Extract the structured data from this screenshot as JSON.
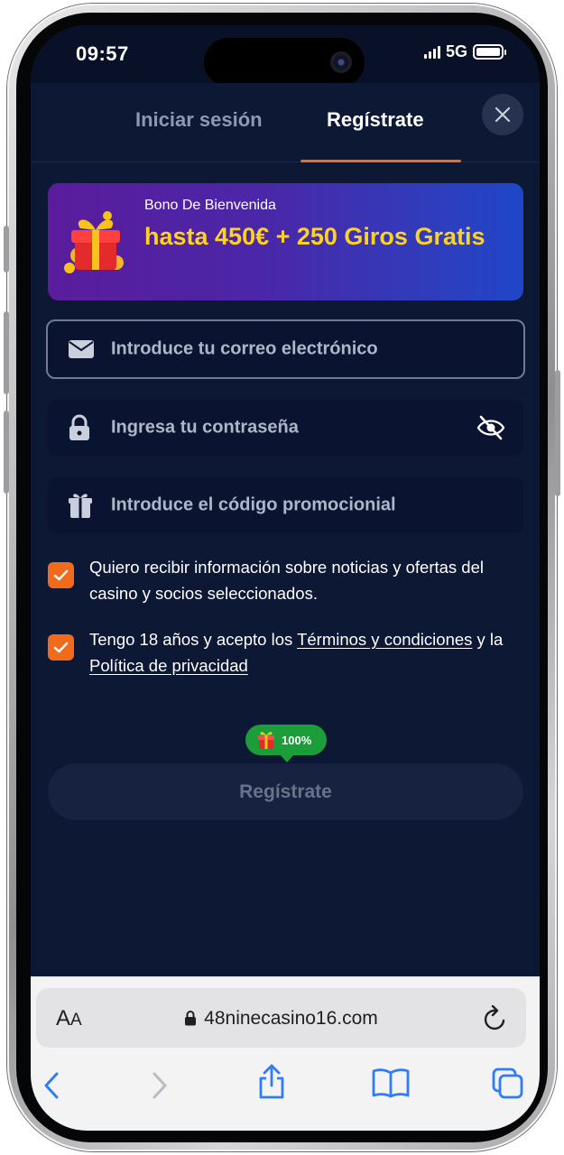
{
  "status_bar": {
    "time": "09:57",
    "network": "5G"
  },
  "tabs": {
    "login": "Iniciar sesión",
    "register": "Regístrate"
  },
  "bonus": {
    "subtitle": "Bono De Bienvenida",
    "title": "hasta 450€ + 250 Giros Gratis"
  },
  "form": {
    "email_placeholder": "Introduce tu correo electrónico",
    "password_placeholder": "Ingresa tu contraseña",
    "promo_placeholder": "Introduce el código promocionial"
  },
  "consents": {
    "news_text": "Quiero recibir información sobre noticias y ofertas del casino y socios seleccionados.",
    "terms_prefix": "Tengo 18 años y acepto los ",
    "terms_link": "Términos y condiciones",
    "terms_middle": " y la ",
    "privacy_link": "Política de privacidad"
  },
  "submit": {
    "badge": "100%",
    "label": "Regístrate"
  },
  "browser": {
    "aa_label_big": "A",
    "aa_label_small": "A",
    "url": "48ninecasino16.com"
  },
  "colors": {
    "accent": "#f26a1b",
    "bonus_text": "#ffd21f",
    "badge_green": "#1b9e3a",
    "background": "#0c1834"
  },
  "icons": [
    "close-icon",
    "gift-icon",
    "mail-icon",
    "lock-icon",
    "eye-off-icon",
    "checkmark-icon",
    "reload-icon",
    "back-icon",
    "forward-icon",
    "share-icon",
    "bookmarks-icon",
    "tabs-icon"
  ]
}
